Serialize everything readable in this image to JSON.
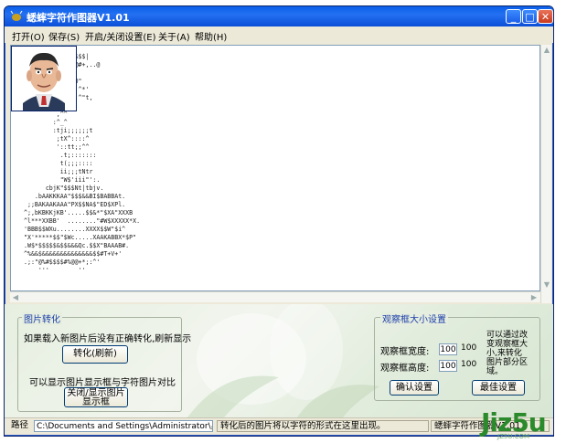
{
  "window": {
    "title": "蟋蟀字符作图器V1.01"
  },
  "titlebar_buttons": {
    "minimize": "_",
    "maximize": "□",
    "close": "✕"
  },
  "menu": [
    {
      "label": "打开(O)"
    },
    {
      "label": "保存(S)"
    },
    {
      "label": "开启/关闭设置(E)"
    },
    {
      "label": "关于(A)"
    },
    {
      "label": "帮助(H)"
    }
  ],
  "ascii_art": "              $$$|\n              @#+,..@\n\n              0\"\n              ,^*'\n              ,^\"t,\n\n         ,^^\n        :^_^\n        :tji;;;;;;t\n         ;tX^::::^\n         '::tt;;^^\n          .t;:::::::\n          t(;;;::::\n          ii;;;tNtr\n          \"W$'iii\"':.\n      cbjK\"$$$Nt|tbjv.\n   .bAAKKKAA\"$$$&&BI$BABBAt.\n ;;BAKAAKAAA\"PX$$NA$\"ED$XPl.\n^;,bKBKKjKB'.....$$&*\"$XA\"XXXB\n^l***XXBB'  ........\"#W$XXXXX*X.\n'BBB$$WXu........XXXX$$W\"$i^\n\"X'*****$$\"$Wc.....XAAKABBX*$P\"\n.W$*$$$$$&$$&&&Qc.$$X\"BAAAB#.\n^%&&$&&&&&&&&&&&&&&$$#T+V+'\n.;:\"@%#$$$$#%@@+*;:^'\n    '''        ''",
  "group_convert": {
    "title": "图片转化",
    "hint": "如果载入新图片后没有正确转化,刷新显示",
    "convert_button": "转化(刷新)",
    "compare_hint": "可以显示图片显示框与字符图片对比",
    "toggle_button_line1": "关闭/显示图片",
    "toggle_button_line2": "显示框"
  },
  "group_viewer": {
    "title": "观察框大小设置",
    "width_label": "观察框宽度:",
    "width_value": "100",
    "width_display": "100",
    "height_label": "观察框高度:",
    "height_value": "100",
    "height_display": "100",
    "note_lines": [
      "可以通过改",
      "变观察框大",
      "小,来转化",
      "图片部分区",
      "域。"
    ],
    "confirm_button": "确认设置",
    "best_button": "最佳设置"
  },
  "status": {
    "path_label": "路径",
    "path_value": "C:\\Documents and Settings\\Administrator\\桌面\\tu\\tou.j",
    "message": "转化后的图片将以字符的形式在这里出现。",
    "app_name": "蟋蟀字符作图器V1.01"
  },
  "watermark": {
    "text": "Jiz5u",
    "sub": "JZ5U.COM"
  }
}
